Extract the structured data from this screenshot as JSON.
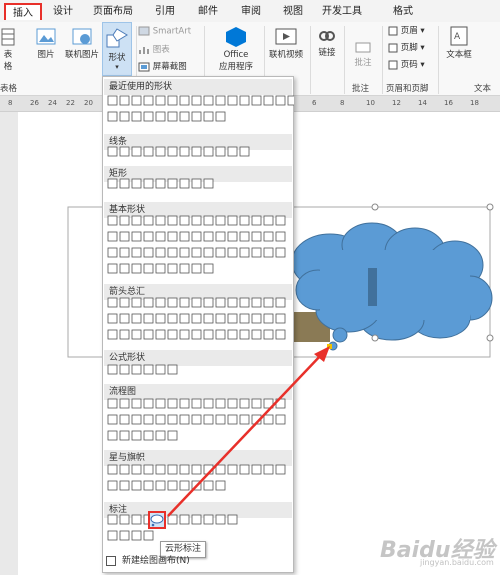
{
  "tabs": [
    "插入",
    "设计",
    "页面布局",
    "引用",
    "邮件",
    "审阅",
    "视图",
    "开发工具",
    "格式"
  ],
  "ribbon": {
    "table_label": "表格",
    "picture": "图片",
    "online_picture": "联机图片",
    "shapes": "形状",
    "smartart": "SmartArt",
    "chart": "图表",
    "screenshot": "屏幕截图",
    "office_apps_1": "Office",
    "office_apps_2": "应用程序",
    "online_video": "联机视频",
    "link": "链接",
    "comment": "批注",
    "header": "页眉",
    "footer": "页脚",
    "page_number": "页码",
    "textbox": "文本框",
    "group_comment": "批注",
    "group_header_footer": "页眉和页脚",
    "group_text": "文本"
  },
  "ruler_numbers": [
    "8",
    "26",
    "24",
    "22",
    "20",
    "18",
    "16",
    "14",
    "12",
    "10",
    "8",
    "6",
    "4",
    "2"
  ],
  "ruler_right_numbers": [
    "6",
    "8",
    "10",
    "12",
    "14",
    "16",
    "18"
  ],
  "menu": {
    "recent": "最近使用的形状",
    "lines": "线条",
    "rect": "矩形",
    "basic": "基本形状",
    "arrows": "箭头总汇",
    "equation": "公式形状",
    "flowchart": "流程图",
    "stars": "星与旗帜",
    "callouts": "标注",
    "new_canvas": "新建绘图画布(N)"
  },
  "tooltip": "云形标注",
  "watermark": "Baidu经验",
  "watermark_sub": "jingyan.baidu.com",
  "colors": {
    "accent": "#e8302a",
    "cloud": "#5b9bd5",
    "cloud_bar": "#41719c"
  }
}
